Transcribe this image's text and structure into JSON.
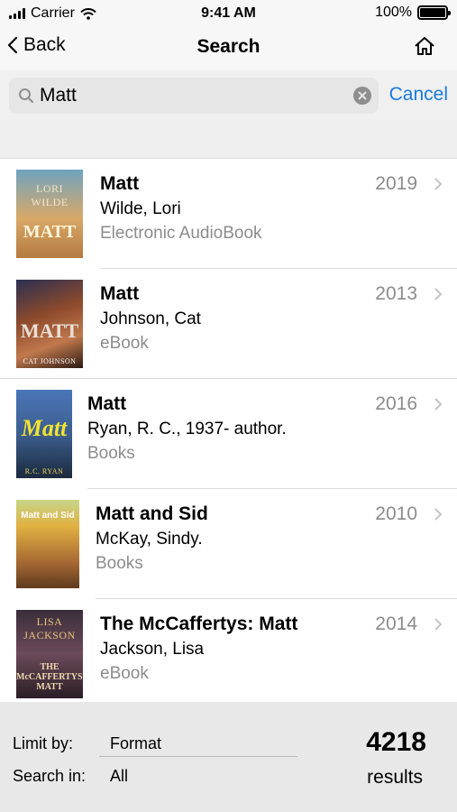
{
  "status_bar": {
    "carrier": "Carrier",
    "time": "9:41 AM",
    "battery": "100%"
  },
  "nav": {
    "back_label": "Back",
    "title": "Search",
    "home_icon": "home-icon"
  },
  "search": {
    "value": "Matt",
    "cancel_label": "Cancel"
  },
  "results": [
    {
      "title": "Matt",
      "author": "Wilde, Lori",
      "format": "Electronic AudioBook",
      "year": "2019",
      "cover_text": "MATT",
      "cover_author": "LORI WILDE"
    },
    {
      "title": "Matt",
      "author": "Johnson, Cat",
      "format": "eBook",
      "year": "2013",
      "cover_text": "MATT",
      "cover_author": "CAT JOHNSON"
    },
    {
      "title": "Matt",
      "author": "Ryan, R. C., 1937- author.",
      "format": "Books",
      "year": "2016",
      "cover_text": "Matt",
      "cover_author": "R.C. RYAN"
    },
    {
      "title": "Matt and Sid",
      "author": "McKay, Sindy.",
      "format": "Books",
      "year": "2010",
      "cover_text": "Matt and Sid",
      "cover_author": ""
    },
    {
      "title": "The McCaffertys: Matt",
      "author": "Jackson, Lisa",
      "format": "eBook",
      "year": "2014",
      "cover_text": "THE McCAFFERTYS: MATT",
      "cover_author": "LISA JACKSON"
    }
  ],
  "bottom": {
    "limit_label": "Limit by:",
    "limit_value": "Format",
    "search_in_label": "Search in:",
    "search_in_value": "All",
    "count": "4218",
    "results_label": "results"
  }
}
